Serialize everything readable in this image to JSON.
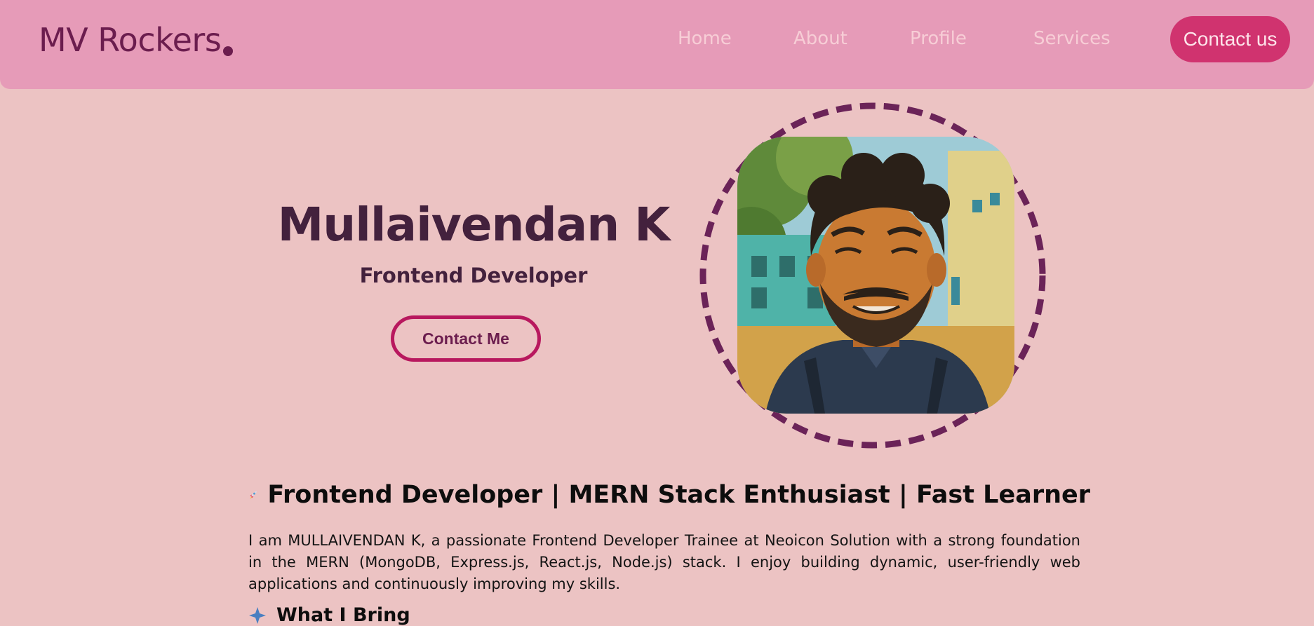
{
  "brand": {
    "name": "MV Rockers",
    "dot_color": "#6b1d4e"
  },
  "nav": {
    "links": [
      {
        "label": "Home"
      },
      {
        "label": "About"
      },
      {
        "label": "Profile"
      },
      {
        "label": "Services"
      }
    ],
    "cta_label": "Contact us"
  },
  "hero": {
    "name": "Mullaivendan K",
    "role": "Frontend Developer",
    "cta_label": "Contact Me",
    "avatar_icon": "avatar-illustration"
  },
  "about": {
    "tagline_icon": "rocket-icon",
    "tagline": "Frontend Developer | MERN Stack Enthusiast | Fast Learner",
    "paragraph": "I am MULLAIVENDAN K, a passionate Frontend Developer Trainee at Neoicon Solution with a strong foundation in the MERN (MongoDB, Express.js, React.js, Node.js) stack. I enjoy building dynamic, user-friendly web applications and continuously improving my skills.",
    "next_heading_icon": "sparkle-icon",
    "next_heading": "What I Bring"
  },
  "colors": {
    "page_background": "#ecc3c3",
    "navbar_background": "#e69bb8",
    "brand_text": "#6b1d4e",
    "nav_link": "#f7cdd6",
    "cta_background": "#d0336f",
    "heading_text": "#43213d",
    "ring_dash": "#6b2358",
    "button_border": "#b8185e"
  }
}
